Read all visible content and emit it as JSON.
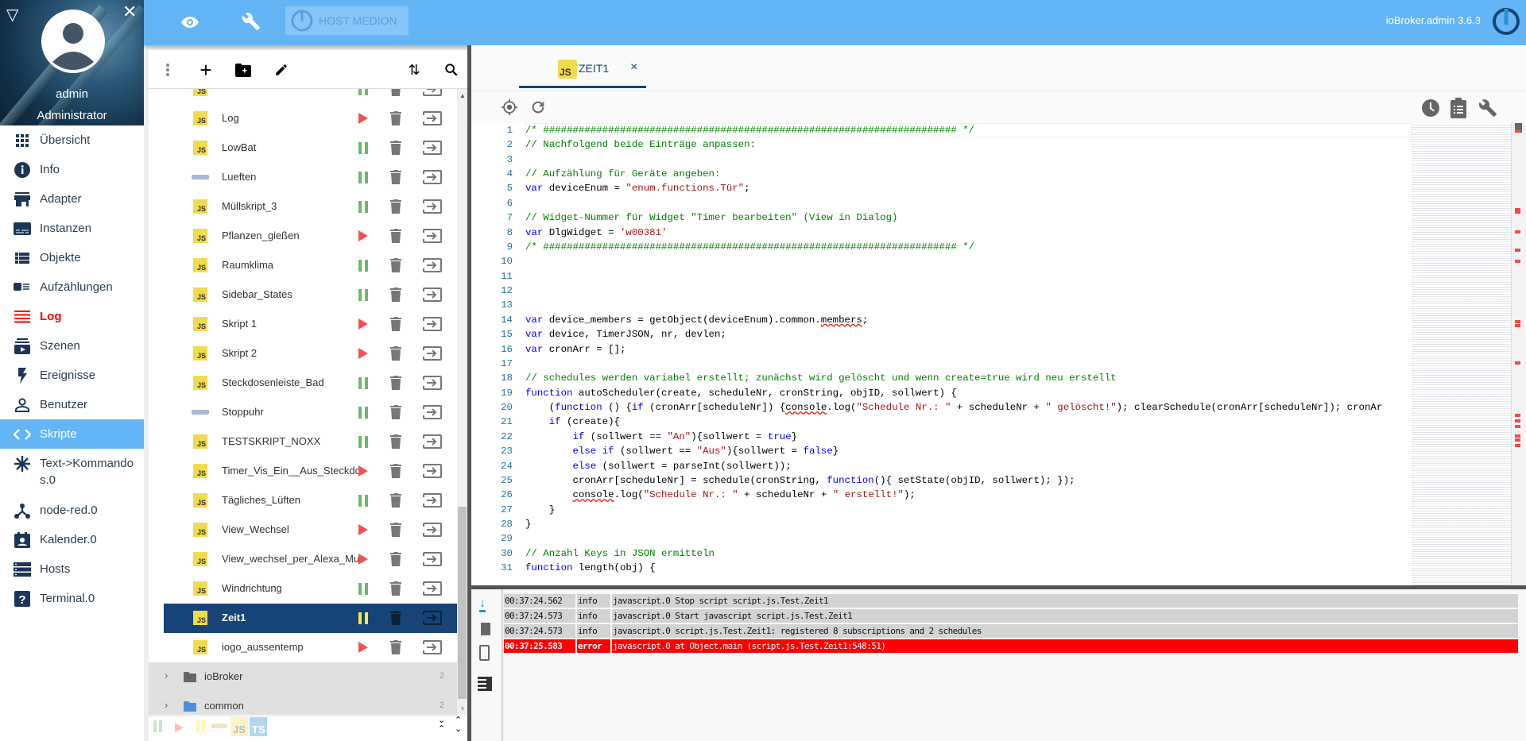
{
  "sidebar": {
    "user": "admin",
    "role": "Administrator",
    "items": [
      {
        "label": "Übersicht",
        "icon": "apps-icon"
      },
      {
        "label": "Info",
        "icon": "info-icon"
      },
      {
        "label": "Adapter",
        "icon": "store-icon"
      },
      {
        "label": "Instanzen",
        "icon": "subtitles-icon"
      },
      {
        "label": "Objekte",
        "icon": "list-icon"
      },
      {
        "label": "Aufzählungen",
        "icon": "enum-icon"
      },
      {
        "label": "Log",
        "icon": "log-icon",
        "state": "alert"
      },
      {
        "label": "Szenen",
        "icon": "subscriptions-icon"
      },
      {
        "label": "Ereignisse",
        "icon": "flash-icon"
      },
      {
        "label": "Benutzer",
        "icon": "person-icon"
      },
      {
        "label": "Skripte",
        "icon": "code-icon",
        "state": "active"
      },
      {
        "label": "Text->Kommandos.0",
        "icon": "snowflake-icon"
      },
      {
        "label": "node-red.0",
        "icon": "graph-icon"
      },
      {
        "label": "Kalender.0",
        "icon": "calendar-icon"
      },
      {
        "label": "Hosts",
        "icon": "storage-icon"
      },
      {
        "label": "Terminal.0",
        "icon": "help-icon"
      }
    ]
  },
  "topbar": {
    "host": "HOST MEDION",
    "version": "ioBroker.admin 3.6.3"
  },
  "scripts": {
    "items": [
      {
        "name": "",
        "type": "js",
        "state": "running"
      },
      {
        "name": "Log",
        "type": "js",
        "state": "stopped"
      },
      {
        "name": "LowBat",
        "type": "js",
        "state": "running"
      },
      {
        "name": "Lueften",
        "type": "blockly",
        "state": "running"
      },
      {
        "name": "Müllskript_3",
        "type": "js",
        "state": "running"
      },
      {
        "name": "Pflanzen_gießen",
        "type": "js",
        "state": "stopped"
      },
      {
        "name": "Raumklima",
        "type": "js",
        "state": "running"
      },
      {
        "name": "Sidebar_States",
        "type": "js",
        "state": "running"
      },
      {
        "name": "Skript 1",
        "type": "js",
        "state": "stopped"
      },
      {
        "name": "Skript 2",
        "type": "js",
        "state": "stopped"
      },
      {
        "name": "Steckdosenleiste_Bad",
        "type": "js",
        "state": "running"
      },
      {
        "name": "Stoppuhr",
        "type": "blockly",
        "state": "running"
      },
      {
        "name": "TESTSKRIPT_NOXX",
        "type": "js",
        "state": "running"
      },
      {
        "name": "Timer_Vis_Ein__Aus_Steckdo",
        "type": "js",
        "state": "stopped"
      },
      {
        "name": "Tägliches_Lüften",
        "type": "js",
        "state": "running"
      },
      {
        "name": "View_Wechsel",
        "type": "js",
        "state": "stopped"
      },
      {
        "name": "View_wechsel_per_Alexa_Mul",
        "type": "js",
        "state": "stopped"
      },
      {
        "name": "Windrichtung",
        "type": "js",
        "state": "running"
      },
      {
        "name": "Zeit1",
        "type": "js",
        "state": "paused",
        "selected": true
      },
      {
        "name": "iogo_aussentemp",
        "type": "js",
        "state": "stopped"
      }
    ],
    "folders": [
      {
        "name": "ioBroker",
        "count": "2",
        "color": "#666666"
      },
      {
        "name": "common",
        "count": "2",
        "color": "#4a90e2"
      }
    ],
    "filters": {
      "js": "JS",
      "ts": "TS"
    }
  },
  "editor": {
    "tab": {
      "label": "ZEIT1",
      "icon_text": "JS",
      "close": "×"
    },
    "code": [
      [
        [
          "c",
          "/* ###################################################################### */"
        ]
      ],
      [
        [
          "c",
          "// Nachfolgend beide Einträge anpassen:"
        ]
      ],
      [],
      [
        [
          "c",
          "// Aufzählung für Geräte angeben:"
        ]
      ],
      [
        [
          "k",
          "var"
        ],
        [
          "d",
          " deviceEnum = "
        ],
        [
          "s",
          "\"enum.functions.Tür\""
        ],
        [
          "d",
          ";"
        ]
      ],
      [],
      [
        [
          "c",
          "// Widget-Nummer für Widget \"Timer bearbeiten\" (View in Dialog)"
        ]
      ],
      [
        [
          "k",
          "var"
        ],
        [
          "d",
          " DlgWidget = "
        ],
        [
          "s",
          "'w00381'"
        ]
      ],
      [
        [
          "c",
          "/* ###################################################################### */"
        ]
      ],
      [],
      [],
      [],
      [],
      [
        [
          "k",
          "var"
        ],
        [
          "d",
          " device_members = getObject(deviceEnum).common."
        ],
        [
          "u",
          "members"
        ],
        [
          "d",
          ";"
        ]
      ],
      [
        [
          "k",
          "var"
        ],
        [
          "d",
          " device, TimerJSON, nr, devlen;"
        ]
      ],
      [
        [
          "k",
          "var"
        ],
        [
          "d",
          " cronArr = [];"
        ]
      ],
      [],
      [
        [
          "c",
          "// schedules werden variabel erstellt; zunächst wird gelöscht und wenn create=true wird neu erstellt"
        ]
      ],
      [
        [
          "k",
          "function"
        ],
        [
          "d",
          " autoScheduler(create, scheduleNr, cronString, objID, sollwert) {"
        ]
      ],
      [
        [
          "d",
          "    ("
        ],
        [
          "k",
          "function"
        ],
        [
          "d",
          " () {"
        ],
        [
          "k",
          "if"
        ],
        [
          "d",
          " (cronArr[scheduleNr]) {"
        ],
        [
          "u",
          "console"
        ],
        [
          "d",
          ".log("
        ],
        [
          "s",
          "\"Schedule Nr.: \""
        ],
        [
          "d",
          " + scheduleNr + "
        ],
        [
          "s",
          "\" gelöscht!\""
        ],
        [
          "d",
          "); clearSchedule(cronArr[scheduleNr]); cronAr"
        ]
      ],
      [
        [
          "d",
          "    "
        ],
        [
          "k",
          "if"
        ],
        [
          "d",
          " (create){"
        ]
      ],
      [
        [
          "d",
          "        "
        ],
        [
          "k",
          "if"
        ],
        [
          "d",
          " (sollwert == "
        ],
        [
          "s",
          "\"An\""
        ],
        [
          "d",
          "){sollwert = "
        ],
        [
          "k",
          "true"
        ],
        [
          "d",
          "}"
        ]
      ],
      [
        [
          "d",
          "        "
        ],
        [
          "k",
          "else if"
        ],
        [
          "d",
          " (sollwert == "
        ],
        [
          "s",
          "\"Aus\""
        ],
        [
          "d",
          "){sollwert = "
        ],
        [
          "k",
          "false"
        ],
        [
          "d",
          "}"
        ]
      ],
      [
        [
          "d",
          "        "
        ],
        [
          "k",
          "else"
        ],
        [
          "d",
          " (sollwert = parseInt(sollwert));"
        ]
      ],
      [
        [
          "d",
          "        cronArr[scheduleNr] = schedule(cronString, "
        ],
        [
          "k",
          "function"
        ],
        [
          "d",
          "(){ setState(objID, sollwert); });"
        ]
      ],
      [
        [
          "d",
          "        "
        ],
        [
          "u",
          "console"
        ],
        [
          "d",
          ".log("
        ],
        [
          "s",
          "\"Schedule Nr.: \""
        ],
        [
          "d",
          " + scheduleNr + "
        ],
        [
          "s",
          "\" erstellt!\""
        ],
        [
          "d",
          ");"
        ]
      ],
      [
        [
          "d",
          "    }"
        ]
      ],
      [
        [
          "d",
          "}"
        ]
      ],
      [],
      [
        [
          "c",
          "// Anzahl Keys in JSON ermitteln"
        ]
      ],
      [
        [
          "k",
          "function"
        ],
        [
          "d",
          " length(obj) {"
        ]
      ]
    ]
  },
  "log": {
    "rows": [
      {
        "time": "00:37:24.562",
        "level": "info",
        "msg": "javascript.0 Stop script script.js.Test.Zeit1"
      },
      {
        "time": "00:37:24.573",
        "level": "info",
        "msg": "javascript.0 Start javascript script.js.Test.Zeit1"
      },
      {
        "time": "00:37:24.573",
        "level": "info",
        "msg": "javascript.0 script.js.Test.Zeit1: registered 8 subscriptions and 2 schedules"
      },
      {
        "time": "00:37:25.583",
        "level": "error",
        "msg": "javascript.0 at Object.main (script.js.Test.Zeit1:548:51)"
      }
    ]
  },
  "colors": {
    "accent": "#64b5f6",
    "selected": "#164477",
    "error": "#ff0000",
    "running": "#66bb6a",
    "stopped": "#ef5350",
    "paused": "#ffeb3b"
  }
}
